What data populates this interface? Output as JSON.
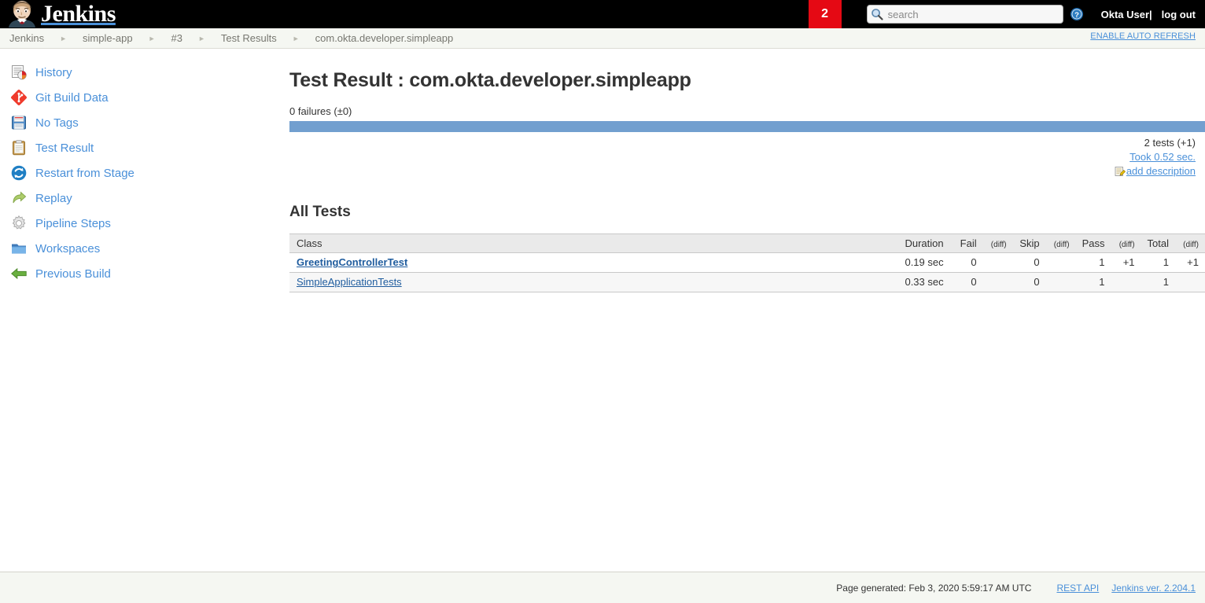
{
  "header": {
    "brand": "Jenkins",
    "brand_logo_icon": "jenkins-butler-icon",
    "build_badge": "2",
    "search_placeholder": "search",
    "search_value": "",
    "search_icon": "search-icon",
    "help_icon": "help-circle-icon",
    "user_name": "Okta User",
    "logout_separator": "|",
    "logout_label": "log out",
    "badge_color": "#e50914",
    "bar_color": "#000000"
  },
  "breadcrumb": {
    "items": [
      "Jenkins",
      "simple-app",
      "#3",
      "Test Results",
      "com.okta.developer.simpleapp"
    ],
    "separator_icon": "chevron-right-icon",
    "auto_refresh_label": "ENABLE AUTO REFRESH"
  },
  "sidebar": {
    "items": [
      {
        "label": "History",
        "icon": "history-chart-icon"
      },
      {
        "label": "Git Build Data",
        "icon": "git-diamond-icon"
      },
      {
        "label": "No Tags",
        "icon": "floppy-disk-icon"
      },
      {
        "label": "Test Result",
        "icon": "clipboard-icon"
      },
      {
        "label": "Restart from Stage",
        "icon": "restart-circular-arrows-icon"
      },
      {
        "label": "Replay",
        "icon": "replay-arrow-icon"
      },
      {
        "label": "Pipeline Steps",
        "icon": "gear-icon"
      },
      {
        "label": "Workspaces",
        "icon": "folder-icon"
      },
      {
        "label": "Previous Build",
        "icon": "left-arrow-icon"
      }
    ]
  },
  "main": {
    "page_title": "Test Result : com.okta.developer.simpleapp",
    "failures_line": "0 failures (±0)",
    "result_bar_color": "#729fcf",
    "result_bar_percent": 100,
    "stats": {
      "tests_count": "2 tests (+1)",
      "took_label": "Took 0.52 sec.",
      "add_description_label": "add description",
      "add_description_icon": "notepad-pencil-icon"
    },
    "all_tests_title": "All Tests",
    "table": {
      "headers": {
        "class": "Class",
        "duration": "Duration",
        "fail": "Fail",
        "fail_diff": "(diff)",
        "skip": "Skip",
        "skip_diff": "(diff)",
        "pass": "Pass",
        "pass_diff": "(diff)",
        "total": "Total",
        "total_diff": "(diff)"
      },
      "rows": [
        {
          "class": "GreetingControllerTest",
          "bold": true,
          "duration": "0.19 sec",
          "fail": "0",
          "fail_diff": "",
          "skip": "0",
          "skip_diff": "",
          "pass": "1",
          "pass_diff": "+1",
          "total": "1",
          "total_diff": "+1"
        },
        {
          "class": "SimpleApplicationTests",
          "bold": false,
          "duration": "0.33 sec",
          "fail": "0",
          "fail_diff": "",
          "skip": "0",
          "skip_diff": "",
          "pass": "1",
          "pass_diff": "",
          "total": "1",
          "total_diff": ""
        }
      ]
    }
  },
  "footer": {
    "page_generated": "Page generated: Feb 3, 2020 5:59:17 AM UTC",
    "rest_api_label": "REST API",
    "version_label": "Jenkins ver. 2.204.1"
  }
}
